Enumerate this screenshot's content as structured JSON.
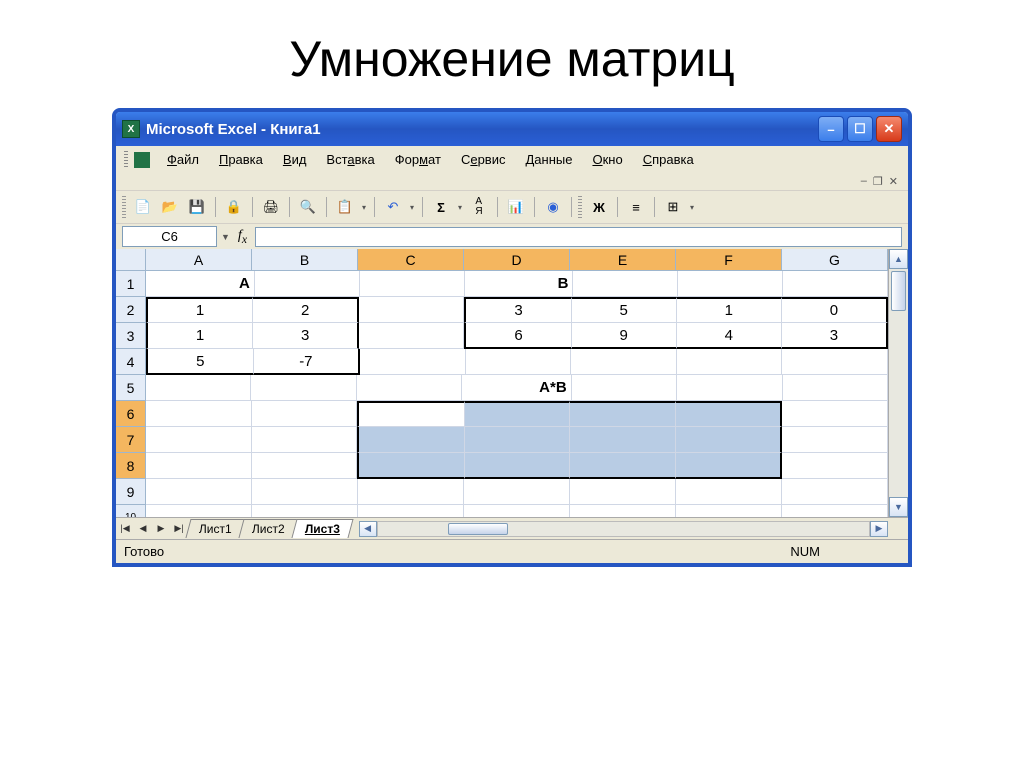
{
  "slide": {
    "title": "Умножение матриц"
  },
  "titlebar": {
    "text": "Microsoft Excel - Книга1"
  },
  "menu": {
    "file": "Файл",
    "edit": "Правка",
    "view": "Вид",
    "insert": "Вставка",
    "format": "Формат",
    "service": "Сервис",
    "data": "Данные",
    "window": "Окно",
    "help": "Справка"
  },
  "namebox": "C6",
  "columns": [
    "A",
    "B",
    "C",
    "D",
    "E",
    "F",
    "G"
  ],
  "rows": [
    "1",
    "2",
    "3",
    "4",
    "5",
    "6",
    "7",
    "8",
    "9",
    "10"
  ],
  "labels": {
    "matrixA": "A",
    "matrixB": "B",
    "product": "A*B"
  },
  "matA": [
    [
      "1",
      "2"
    ],
    [
      "1",
      "3"
    ],
    [
      "5",
      "-7"
    ]
  ],
  "matB": [
    [
      "3",
      "5",
      "1",
      "0"
    ],
    [
      "6",
      "9",
      "4",
      "3"
    ]
  ],
  "tabs": {
    "s1": "Лист1",
    "s2": "Лист2",
    "s3": "Лист3"
  },
  "status": {
    "ready": "Готово",
    "num": "NUM"
  }
}
